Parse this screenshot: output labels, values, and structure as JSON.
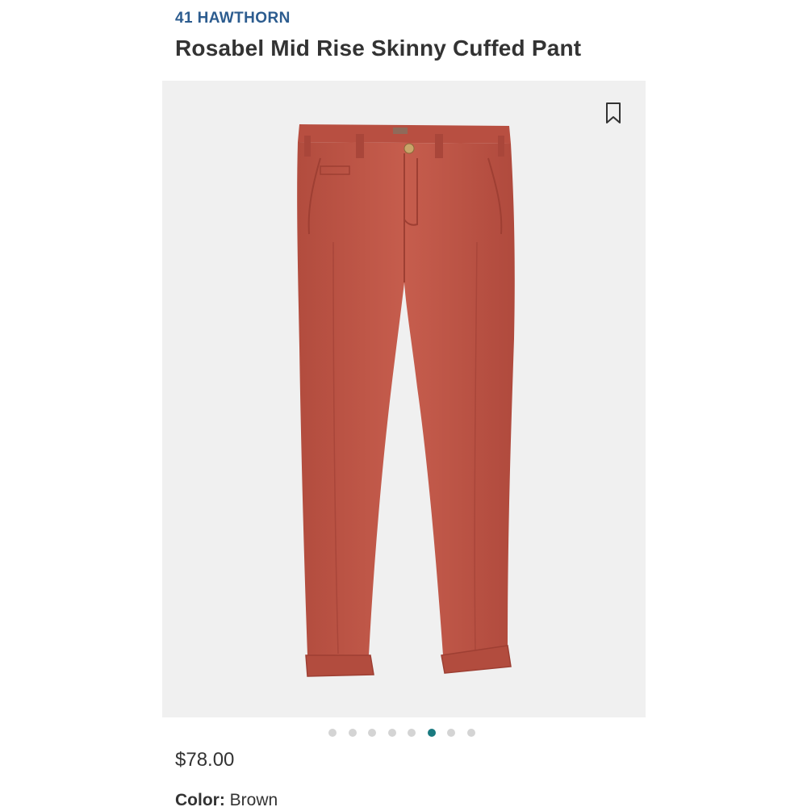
{
  "product": {
    "brand": "41 HAWTHORN",
    "title": "Rosabel Mid Rise Skinny Cuffed Pant",
    "price": "$78.00",
    "color_label": "Color:",
    "color_value": "Brown"
  },
  "gallery": {
    "image_subject": "pants-icon",
    "image_color": "#c2594a",
    "background_color": "#f0f0f0",
    "bookmark_icon": "bookmark-icon",
    "dot_count": 8,
    "active_dot_index": 5
  },
  "colors": {
    "brand": "#2c5c8f",
    "active_dot": "#1a7a80",
    "inactive_dot": "#d4d4d4",
    "text": "#333333"
  }
}
